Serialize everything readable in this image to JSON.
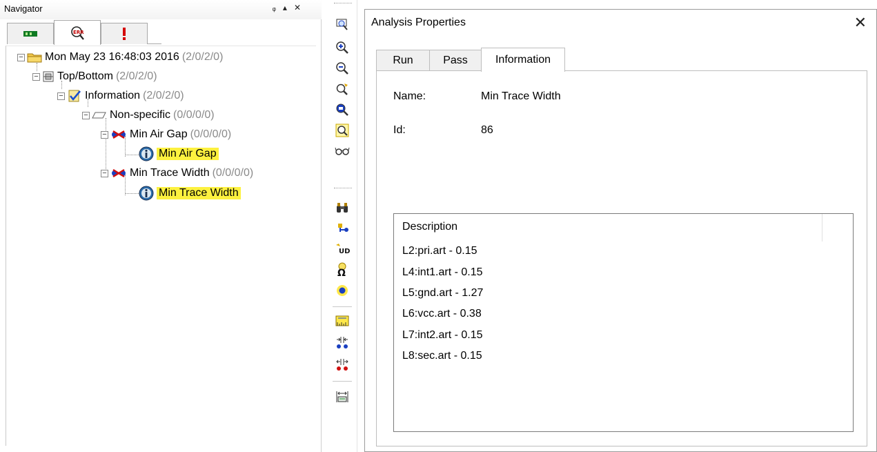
{
  "navigator": {
    "title": "Navigator",
    "title_icons": [
      "pin-icon",
      "dropdown-icon",
      "close-icon"
    ],
    "tabs": [
      {
        "icon": "board-icon",
        "color": "#1a8a2a"
      },
      {
        "icon": "drc-error-icon",
        "color": "#c00000"
      },
      {
        "icon": "exclamation-icon",
        "color": "#d40000"
      }
    ],
    "tree": [
      {
        "label": "Mon May 23 16:48:03 2016",
        "count": "(2/0/2/0)",
        "icon": "folder-icon"
      },
      {
        "label": "Top/Bottom",
        "count": "(2/0/2/0)",
        "icon": "layer-stack-icon"
      },
      {
        "label": "Information",
        "count": "(2/0/2/0)",
        "icon": "checked-document-icon"
      },
      {
        "label": "Non-specific",
        "count": "(0/0/0/0)",
        "icon": "layer-icon"
      },
      {
        "label": "Min Air Gap",
        "count": "(0/0/0/0)",
        "icon": "air-gap-icon"
      },
      {
        "label": "Min Air Gap",
        "count": "",
        "icon": "info-icon",
        "highlighted": true
      },
      {
        "label": "Min Trace Width",
        "count": "(0/0/0/0)",
        "icon": "trace-width-icon"
      },
      {
        "label": "Min Trace Width",
        "count": "",
        "icon": "info-icon",
        "highlighted": true
      }
    ]
  },
  "toolbar": {
    "tools": [
      "zoom-window-icon",
      "zoom-in-icon",
      "zoom-out-icon",
      "zoom-previous-icon",
      "zoom-fit-icon",
      "zoom-selection-icon",
      "glasses-icon",
      "binoculars-icon",
      "net-highlight-icon",
      "ud-icon",
      "omega-icon",
      "sun-icon",
      "ruler-icon",
      "align-in-icon",
      "align-out-icon",
      "measure-icon"
    ]
  },
  "dialog": {
    "title": "Analysis Properties",
    "close": "✕",
    "tabs": [
      "Run",
      "Pass",
      "Information"
    ],
    "active_tab": "Information",
    "name_label": "Name:",
    "name_value": "Min Trace Width",
    "id_label": "Id:",
    "id_value": "86",
    "description_header": "Description",
    "description_lines": [
      "L2:pri.art - 0.15",
      "L4:int1.art - 0.15",
      "L5:gnd.art - 1.27",
      "L6:vcc.art - 0.38",
      "L7:int2.art - 0.15",
      "L8:sec.art - 0.15"
    ]
  },
  "colors": {
    "highlight": "#fdf13f",
    "count_text": "#8a8a8a",
    "folder": "#f2c94c"
  }
}
